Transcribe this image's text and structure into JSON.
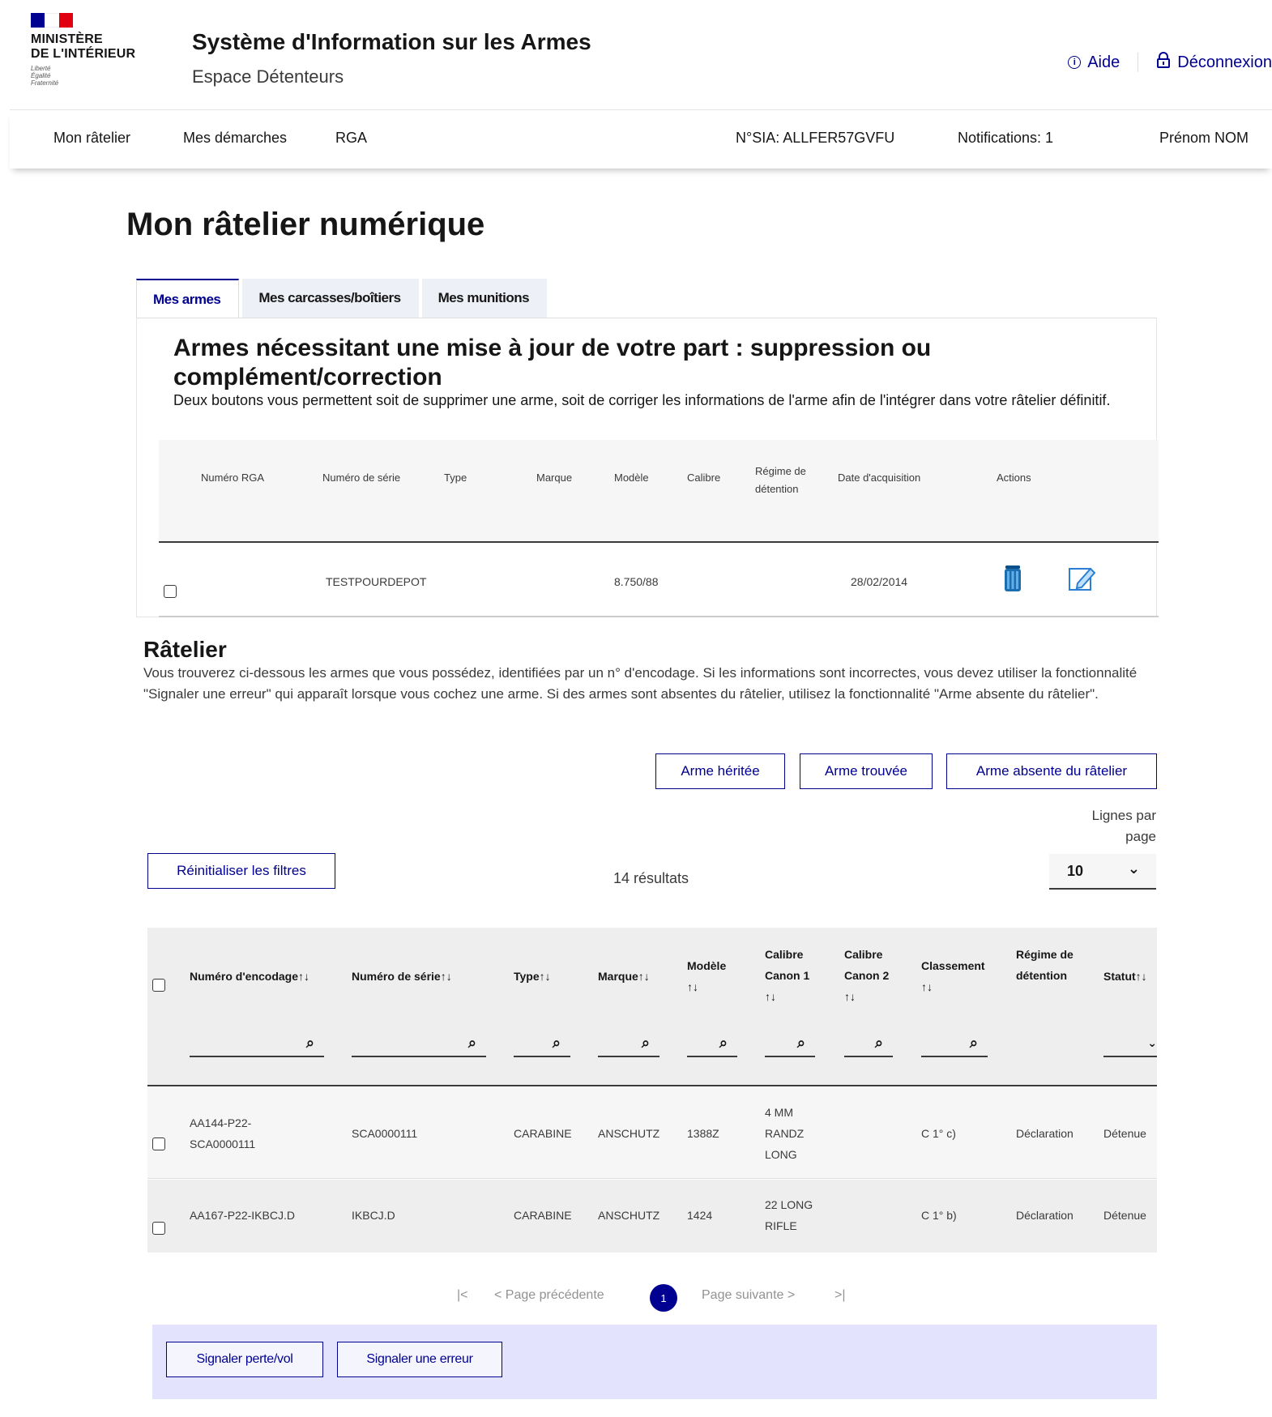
{
  "header": {
    "ministry": "MINISTÈRE\nDE L'INTÉRIEUR",
    "motto": [
      "Liberté",
      "Égalité",
      "Fraternité"
    ],
    "service_title": "Système d'Information sur les Armes",
    "service_tagline": "Espace Détenteurs",
    "help_label": "Aide",
    "logout_label": "Déconnexion"
  },
  "nav": {
    "items": [
      "Mon râtelier",
      "Mes démarches",
      "RGA"
    ],
    "sia": "N°SIA: ALLFER57GVFU",
    "notifications": "Notifications: 1",
    "user": "Prénom NOM"
  },
  "page_title": "Mon râtelier numérique",
  "tabs": [
    "Mes armes",
    "Mes carcasses/boîtiers",
    "Mes munitions"
  ],
  "maj": {
    "title": "Armes nécessitant une mise à jour de votre part : suppression ou complément/correction",
    "description": "Deux boutons vous permettent soit de supprimer une arme, soit de corriger les informations de l'arme afin de l'intégrer dans votre râtelier définitif.",
    "headers": [
      "Numéro RGA",
      "Numéro de série",
      "Type",
      "Marque",
      "Modèle",
      "Calibre",
      "Régime de détention",
      "Date d'acquisition",
      "Actions"
    ],
    "rows": [
      {
        "rga": "",
        "serie": "TESTPOURDEPOT",
        "type": "",
        "marque": "",
        "modele": "8.750/88",
        "calibre": "",
        "regime": "",
        "date": "28/02/2014"
      }
    ]
  },
  "ratelier": {
    "title": "Râtelier",
    "description": "Vous trouverez ci-dessous les armes que vous possédez, identifiées par un n° d'encodage. Si les informations sont incorrectes, vous devez utiliser la fonctionnalité \"Signaler une erreur\" qui apparaît lorsque vous cochez une arme. Si des armes sont absentes du râtelier, utilisez la fonctionnalité \"Arme absente du râtelier\".",
    "btn_heritee": "Arme héritée",
    "btn_trouvee": "Arme trouvée",
    "btn_absente": "Arme absente du râtelier",
    "btn_reset": "Réinitialiser les filtres",
    "lines_label": "Lignes par page",
    "lines_value": "10",
    "results": "14 résultats",
    "headers": {
      "encodage": "Numéro d'encodage",
      "serie": "Numéro de série",
      "type": "Type",
      "marque": "Marque",
      "modele": "Modèle",
      "cal1": "Calibre Canon 1",
      "cal2": "Calibre Canon 2",
      "classement": "Classement",
      "regime": "Régime de détention",
      "statut": "Statut"
    },
    "sort_glyph": "↑↓",
    "rows": [
      {
        "encodage": "AA144-P22-SCA0000111",
        "serie": "SCA0000111",
        "type": "CARABINE",
        "marque": "ANSCHUTZ",
        "modele": "1388Z",
        "cal1": "4 MM RANDZ LONG",
        "cal2": "",
        "classement": "C 1° c)",
        "regime": "Déclaration",
        "statut": "Détenue"
      },
      {
        "encodage": "AA167-P22-IKBCJ.D",
        "serie": "IKBCJ.D",
        "type": "CARABINE",
        "marque": "ANSCHUTZ",
        "modele": "1424",
        "cal1": "22 LONG RIFLE",
        "cal2": "",
        "classement": "C 1° b)",
        "regime": "Déclaration",
        "statut": "Détenue"
      }
    ]
  },
  "pagination": {
    "first": "|<",
    "prev": "< Page précédente",
    "current": "1",
    "next": "Page suivante >",
    "last": ">|"
  },
  "actions": {
    "perte": "Signaler perte/vol",
    "erreur": "Signaler une erreur"
  },
  "colors": {
    "primary": "#000091",
    "flag_blue": "#000091",
    "flag_red": "#e1000f",
    "action_bar": "#e3e3fd"
  }
}
